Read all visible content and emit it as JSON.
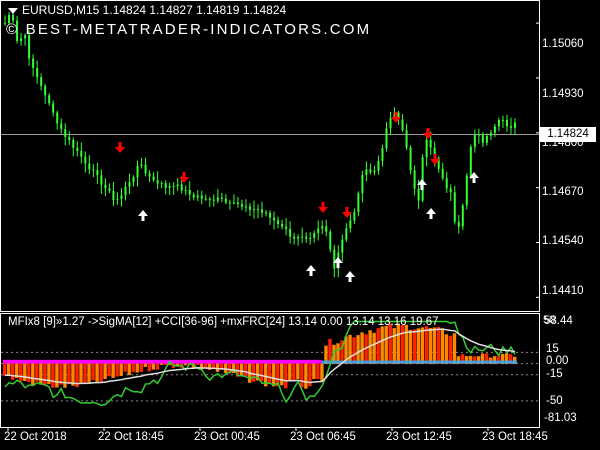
{
  "window": {
    "symbol_header": "EURUSD,M15  1.14824 1.14827 1.14819 1.14824",
    "watermark": "© BEST-METATRADER-INDICATORS.COM",
    "current_price": "1.14824"
  },
  "price_axis": {
    "labels": [
      "1.15060",
      "1.14930",
      "1.14800",
      "1.14670",
      "1.14540",
      "1.14410"
    ]
  },
  "indicator": {
    "header": "MFIx8 [9]»1.27 ->SigMA[12] +CCI[36-96] +mxFRC[24] 13.14 0.00 13.14 13.16 19.67",
    "axis_labels": [
      "58.44",
      "15",
      "0.00",
      "-15",
      "-50",
      "-81.03"
    ],
    "axis_label_top_overlay": "50"
  },
  "time_axis": {
    "labels": [
      "22 Oct 2018",
      "22 Oct 18:45",
      "23 Oct 00:45",
      "23 Oct 06:45",
      "23 Oct 12:45",
      "23 Oct 18:45"
    ]
  },
  "colors": {
    "background": "#000000",
    "candles": "#33ff33",
    "arrow_down": "#ff0000",
    "arrow_up": "#ffffff",
    "histogram_magenta": "#ff00ff",
    "histogram_red": "#ff2200",
    "histogram_orange": "#ff8800",
    "histogram_blue": "#33aaff",
    "signal_white": "#e0e0e0",
    "cci_green": "#33cc33"
  },
  "chart_data": {
    "type": "candlestick",
    "symbol": "EURUSD",
    "timeframe": "M15",
    "ohlc_last": {
      "open": 1.14824,
      "high": 1.14827,
      "low": 1.14819,
      "close": 1.14824
    },
    "price_range": [
      1.1438,
      1.1511
    ],
    "close_path": [
      1.1506,
      1.1509,
      1.1501,
      1.1504,
      1.1496,
      1.1493,
      1.149,
      1.1486,
      1.1483,
      1.148,
      1.1478,
      1.1476,
      1.1474,
      1.1472,
      1.147,
      1.1468,
      1.1466,
      1.1464,
      1.1465,
      1.1468,
      1.147,
      1.1473,
      1.147,
      1.1469,
      1.1468,
      1.1467,
      1.1468,
      1.1467,
      1.1466,
      1.1465,
      1.1465,
      1.1464,
      1.1464,
      1.1465,
      1.1464,
      1.1464,
      1.1463,
      1.1462,
      1.1462,
      1.1462,
      1.1461,
      1.146,
      1.1459,
      1.1458,
      1.1456,
      1.1455,
      1.1455,
      1.1454,
      1.1456,
      1.1458,
      1.1456,
      1.1448,
      1.1454,
      1.1458,
      1.146,
      1.1468,
      1.1472,
      1.147,
      1.1474,
      1.148,
      1.1485,
      1.1483,
      1.1479,
      1.1469,
      1.1463,
      1.148,
      1.1476,
      1.1472,
      1.1468,
      1.1466,
      1.1456,
      1.1464,
      1.1476,
      1.148,
      1.1478,
      1.148,
      1.1482,
      1.1484,
      1.1481,
      1.14824
    ],
    "signals": {
      "sell_arrows_near": [
        "22 Oct 17:30",
        "22 Oct 20:30",
        "23 Oct 06:00",
        "23 Oct 06:30",
        "23 Oct 09:45",
        "23 Oct 10:30",
        "23 Oct 10:45"
      ],
      "buy_arrows_near": [
        "22 Oct 18:45",
        "23 Oct 05:30",
        "23 Oct 06:15",
        "23 Oct 06:45",
        "23 Oct 10:15",
        "23 Oct 10:45",
        "23 Oct 12:00"
      ]
    },
    "indicator_range": [
      -81.03,
      58.44
    ],
    "indicator_levels": [
      15,
      0,
      -15,
      -50
    ]
  }
}
